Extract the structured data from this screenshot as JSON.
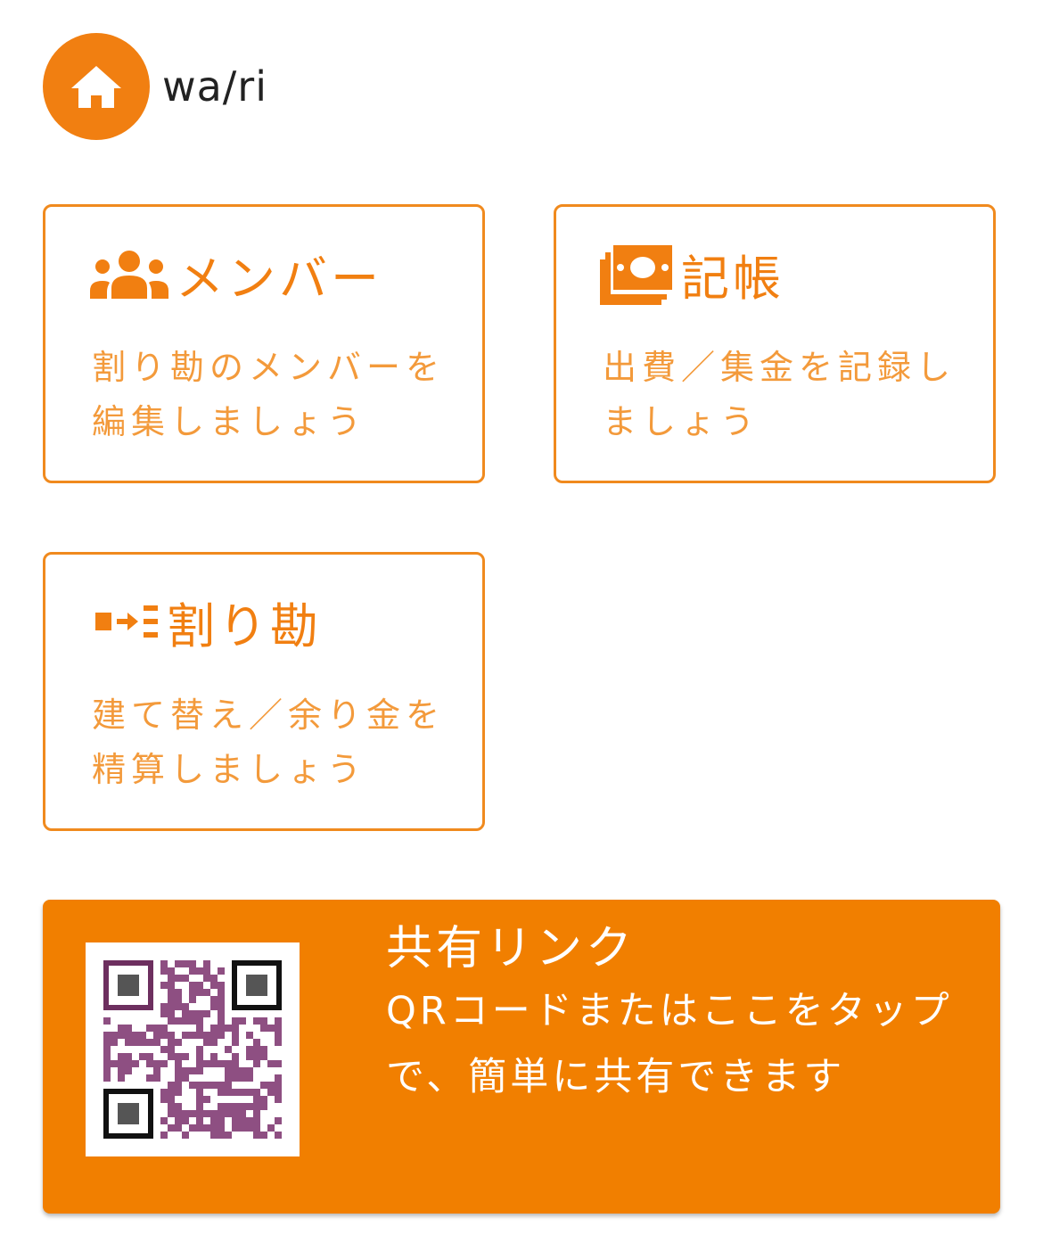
{
  "app": {
    "title": "wa/ri"
  },
  "cards": {
    "members": {
      "title": "メンバー",
      "desc_line1": "割り勘のメンバーを",
      "desc_line2": "編集しましょう",
      "icon": "users-icon"
    },
    "ledger": {
      "title": "記帳",
      "desc_line1": "出費／集金を記録し",
      "desc_line2": "ましょう",
      "icon": "money-bills-icon"
    },
    "split": {
      "title": "割り勘",
      "desc_line1": "建て替え／余り金を",
      "desc_line2": "精算しましょう",
      "icon": "transfer-list-icon"
    }
  },
  "share": {
    "title": "共有リンク",
    "desc_line1": "QRコードまたはここをタップ",
    "desc_line2": "で、簡単に共有できます",
    "qr_icon": "qr-code-icon"
  },
  "colors": {
    "accent": "#f17f11",
    "panel": "#f17f00",
    "qr": "#8e4f82"
  }
}
